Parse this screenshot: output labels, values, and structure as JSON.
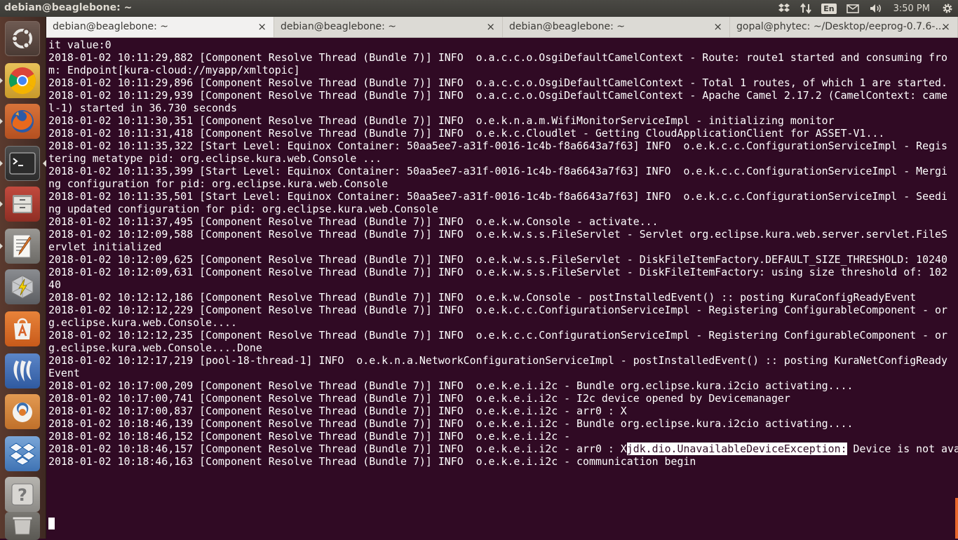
{
  "window_title": "debian@beaglebone: ~",
  "tray": {
    "lang": "En",
    "clock": "3:50 PM"
  },
  "tabs": [
    {
      "label": "debian@beaglebone: ~",
      "close": "×"
    },
    {
      "label": "debian@beaglebone: ~",
      "close": "×"
    },
    {
      "label": "debian@beaglebone: ~",
      "close": "×"
    },
    {
      "label": "gopal@phytec: ~/Desktop/eeprog-0.7.6-...",
      "close": "×"
    }
  ],
  "launcher": [
    "dash-home",
    "chrome",
    "firefox",
    "terminal",
    "files",
    "text-editor",
    "system-tools",
    "software-center",
    "wireshark",
    "blender",
    "dropbox",
    "help",
    "trash"
  ],
  "terminal": {
    "lines": [
      "it value:0",
      "2018-01-02 10:11:29,882 [Component Resolve Thread (Bundle 7)] INFO  o.a.c.c.o.OsgiDefaultCamelContext - Route: route1 started and consuming fro",
      "m: Endpoint[kura-cloud://myapp/xmltopic]",
      "2018-01-02 10:11:29,896 [Component Resolve Thread (Bundle 7)] INFO  o.a.c.c.o.OsgiDefaultCamelContext - Total 1 routes, of which 1 are started.",
      "2018-01-02 10:11:29,939 [Component Resolve Thread (Bundle 7)] INFO  o.a.c.c.o.OsgiDefaultCamelContext - Apache Camel 2.17.2 (CamelContext: came",
      "l-1) started in 36.730 seconds",
      "2018-01-02 10:11:30,351 [Component Resolve Thread (Bundle 7)] INFO  o.e.k.n.a.m.WifiMonitorServiceImpl - initializing monitor",
      "2018-01-02 10:11:31,418 [Component Resolve Thread (Bundle 7)] INFO  o.e.k.c.Cloudlet - Getting CloudApplicationClient for ASSET-V1...",
      "2018-01-02 10:11:35,322 [Start Level: Equinox Container: 50aa5ee7-a31f-0016-1c4b-f8a6643a7f63] INFO  o.e.k.c.c.ConfigurationServiceImpl - Regis",
      "tering metatype pid: org.eclipse.kura.web.Console ...",
      "2018-01-02 10:11:35,399 [Start Level: Equinox Container: 50aa5ee7-a31f-0016-1c4b-f8a6643a7f63] INFO  o.e.k.c.c.ConfigurationServiceImpl - Mergi",
      "ng configuration for pid: org.eclipse.kura.web.Console",
      "2018-01-02 10:11:35,501 [Start Level: Equinox Container: 50aa5ee7-a31f-0016-1c4b-f8a6643a7f63] INFO  o.e.k.c.c.ConfigurationServiceImpl - Seedi",
      "ng updated configuration for pid: org.eclipse.kura.web.Console",
      "2018-01-02 10:11:37,495 [Component Resolve Thread (Bundle 7)] INFO  o.e.k.w.Console - activate...",
      "2018-01-02 10:12:09,588 [Component Resolve Thread (Bundle 7)] INFO  o.e.k.w.s.s.FileServlet - Servlet org.eclipse.kura.web.server.servlet.FileS",
      "ervlet initialized",
      "2018-01-02 10:12:09,625 [Component Resolve Thread (Bundle 7)] INFO  o.e.k.w.s.s.FileServlet - DiskFileItemFactory.DEFAULT_SIZE_THRESHOLD: 10240",
      "2018-01-02 10:12:09,631 [Component Resolve Thread (Bundle 7)] INFO  o.e.k.w.s.s.FileServlet - DiskFileItemFactory: using size threshold of: 102",
      "40",
      "2018-01-02 10:12:12,186 [Component Resolve Thread (Bundle 7)] INFO  o.e.k.w.Console - postInstalledEvent() :: posting KuraConfigReadyEvent",
      "2018-01-02 10:12:12,229 [Component Resolve Thread (Bundle 7)] INFO  o.e.k.c.c.ConfigurationServiceImpl - Registering ConfigurableComponent - or",
      "g.eclipse.kura.web.Console....",
      "2018-01-02 10:12:12,235 [Component Resolve Thread (Bundle 7)] INFO  o.e.k.c.c.ConfigurationServiceImpl - Registering ConfigurableComponent - or",
      "g.eclipse.kura.web.Console....Done",
      "2018-01-02 10:12:17,219 [pool-18-thread-1] INFO  o.e.k.n.a.NetworkConfigurationServiceImpl - postInstalledEvent() :: posting KuraNetConfigReady",
      "Event",
      "2018-01-02 10:17:00,209 [Component Resolve Thread (Bundle 7)] INFO  o.e.k.e.i.i2c - Bundle org.eclipse.kura.i2cio activating....",
      "2018-01-02 10:17:00,741 [Component Resolve Thread (Bundle 7)] INFO  o.e.k.e.i.i2c - I2c device opened by Devicemanager",
      "2018-01-02 10:17:00,837 [Component Resolve Thread (Bundle 7)] INFO  o.e.k.e.i.i2c - arr0 : X",
      "2018-01-02 10:18:46,139 [Component Resolve Thread (Bundle 7)] INFO  o.e.k.e.i.i2c - Bundle org.eclipse.kura.i2cio activating....",
      "2018-01-02 10:18:46,152 [Component Resolve Thread (Bundle 7)] INFO  o.e.k.e.i.i2c - ",
      "2018-01-02 10:18:46,157 [Component Resolve Thread (Bundle 7)] INFO  o.e.k.e.i.i2c - arr0 : X",
      "2018-01-02 10:18:46,163 [Component Resolve Thread (Bundle 7)] INFO  o.e.k.e.i.i2c - communication begin"
    ],
    "highlight_line_index": 32,
    "highlight_text": "jdk.dio.UnavailableDeviceException:",
    "highlight_rest": " Device is not available"
  }
}
